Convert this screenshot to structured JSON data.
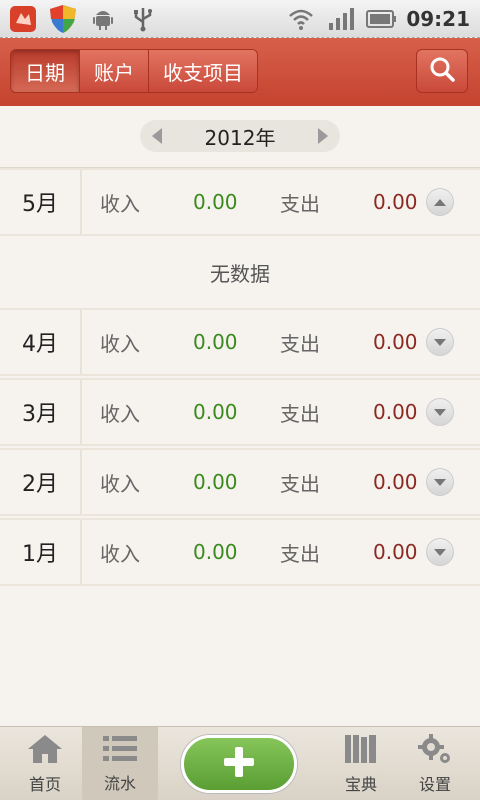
{
  "statusbar": {
    "time": "09:21",
    "left_icons": [
      "app-icon",
      "shield-icon",
      "android-debug-icon",
      "usb-icon"
    ],
    "right_icons": [
      "wifi-icon",
      "signal-icon",
      "battery-icon"
    ]
  },
  "header": {
    "tabs": [
      {
        "label": "日期",
        "active": true
      },
      {
        "label": "账户",
        "active": false
      },
      {
        "label": "收支项目",
        "active": false
      }
    ],
    "search_icon": "search-icon",
    "accent_color": "#c9493a"
  },
  "year_selector": {
    "year": "2012年"
  },
  "rows": [
    {
      "month": "5月",
      "income_label": "收入",
      "income": "0.00",
      "expense_label": "支出",
      "expense": "0.00",
      "expanded": true
    },
    {
      "month": "4月",
      "income_label": "收入",
      "income": "0.00",
      "expense_label": "支出",
      "expense": "0.00",
      "expanded": false
    },
    {
      "month": "3月",
      "income_label": "收入",
      "income": "0.00",
      "expense_label": "支出",
      "expense": "0.00",
      "expanded": false
    },
    {
      "month": "2月",
      "income_label": "收入",
      "income": "0.00",
      "expense_label": "支出",
      "expense": "0.00",
      "expanded": false
    },
    {
      "month": "1月",
      "income_label": "收入",
      "income": "0.00",
      "expense_label": "支出",
      "expense": "0.00",
      "expanded": false
    }
  ],
  "empty_state": "无数据",
  "colors": {
    "income": "#3a8a1e",
    "expense": "#8a2a22"
  },
  "bottomnav": {
    "items": [
      {
        "label": "首页",
        "icon": "home-icon",
        "active": false
      },
      {
        "label": "流水",
        "icon": "list-icon",
        "active": true
      },
      {
        "label": "宝典",
        "icon": "books-icon",
        "active": false
      },
      {
        "label": "设置",
        "icon": "gear-icon",
        "active": false
      }
    ],
    "add_icon": "plus-icon"
  }
}
